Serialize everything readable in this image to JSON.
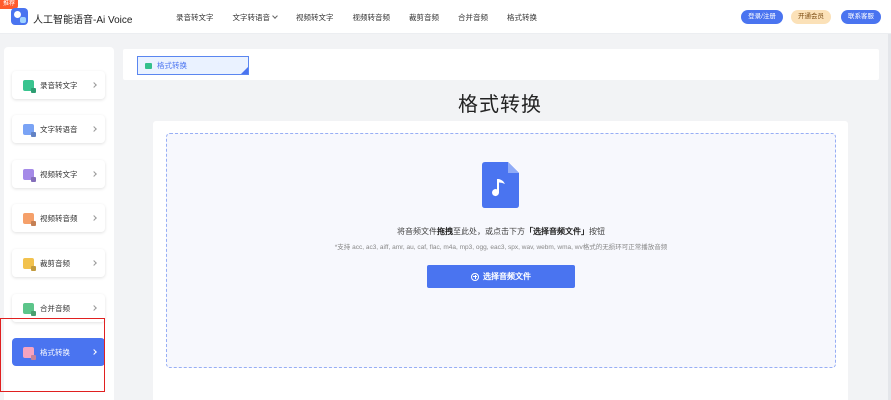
{
  "header": {
    "badge": "推荐",
    "app_title": "人工智能语音-Ai Voice",
    "nav": [
      "录音转文字",
      "文字转语音",
      "视频转文字",
      "视频转音频",
      "裁剪音频",
      "合并音频",
      "格式转换"
    ],
    "login_label": "登录/注册",
    "vip_label": "开通会员",
    "contact_label": "联系客服"
  },
  "sidebar": {
    "items": [
      {
        "label": "录音转文字",
        "icon": "record-to-text-icon",
        "color": "#39c48f"
      },
      {
        "label": "文字转语音",
        "icon": "text-to-speech-icon",
        "color": "#7aa3f5"
      },
      {
        "label": "视频转文字",
        "icon": "video-to-text-icon",
        "color": "#a58ae8"
      },
      {
        "label": "视频转音频",
        "icon": "video-to-audio-icon",
        "color": "#f5a06a"
      },
      {
        "label": "裁剪音频",
        "icon": "trim-audio-icon",
        "color": "#f2c24e"
      },
      {
        "label": "合并音频",
        "icon": "merge-audio-icon",
        "color": "#5cc58a"
      },
      {
        "label": "格式转换",
        "icon": "format-convert-icon",
        "color": "#f6a3c0"
      }
    ],
    "active_index": 6
  },
  "tab": {
    "label": "格式转换"
  },
  "main": {
    "title": "格式转换",
    "drop_prefix": "将音频文件",
    "drop_bold1": "拖拽",
    "drop_middle": "至此处，或点击下方",
    "drop_bold2": "「选择音频文件」",
    "drop_suffix": "按钮",
    "support": "*支持 acc, ac3, aiff, amr, au, caf, flac, m4a, mp3, ogg, eac3, spx, wav, webm, wma, wv格式的无损环可正常播放音频",
    "select_button": "选择音频文件"
  },
  "colors": {
    "accent": "#4a74f0",
    "vip": "#fbe1b8",
    "highlight": "#e02020"
  }
}
